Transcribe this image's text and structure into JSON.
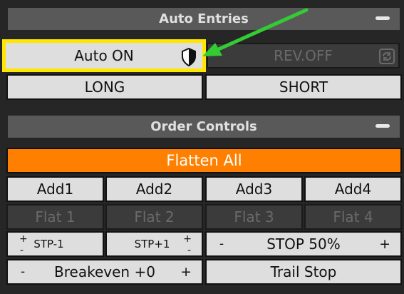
{
  "auto_entries": {
    "title": "Auto Entries",
    "auto_button": "Auto ON",
    "rev_button": "REV.OFF",
    "long_button": "LONG",
    "short_button": "SHORT"
  },
  "order_controls": {
    "title": "Order Controls",
    "flatten_all": "Flatten All",
    "add_buttons": [
      "Add1",
      "Add2",
      "Add3",
      "Add4"
    ],
    "flat_buttons": [
      "Flat 1",
      "Flat 2",
      "Flat 3",
      "Flat 4"
    ],
    "stp_minus": "STP-1",
    "stp_plus": "STP+1",
    "stop_50": "STOP 50%",
    "breakeven": "Breakeven +0",
    "trail_stop": "Trail Stop",
    "plus": "+",
    "minus": "-"
  },
  "colors": {
    "highlight_border": "#ffe600",
    "arrow": "#33cc33",
    "accent_orange": "#ff8000"
  },
  "icons": {
    "shield": "shield-icon",
    "refresh": "refresh-icon",
    "collapse": "minus-icon",
    "annotation_arrow": "arrow-icon"
  }
}
